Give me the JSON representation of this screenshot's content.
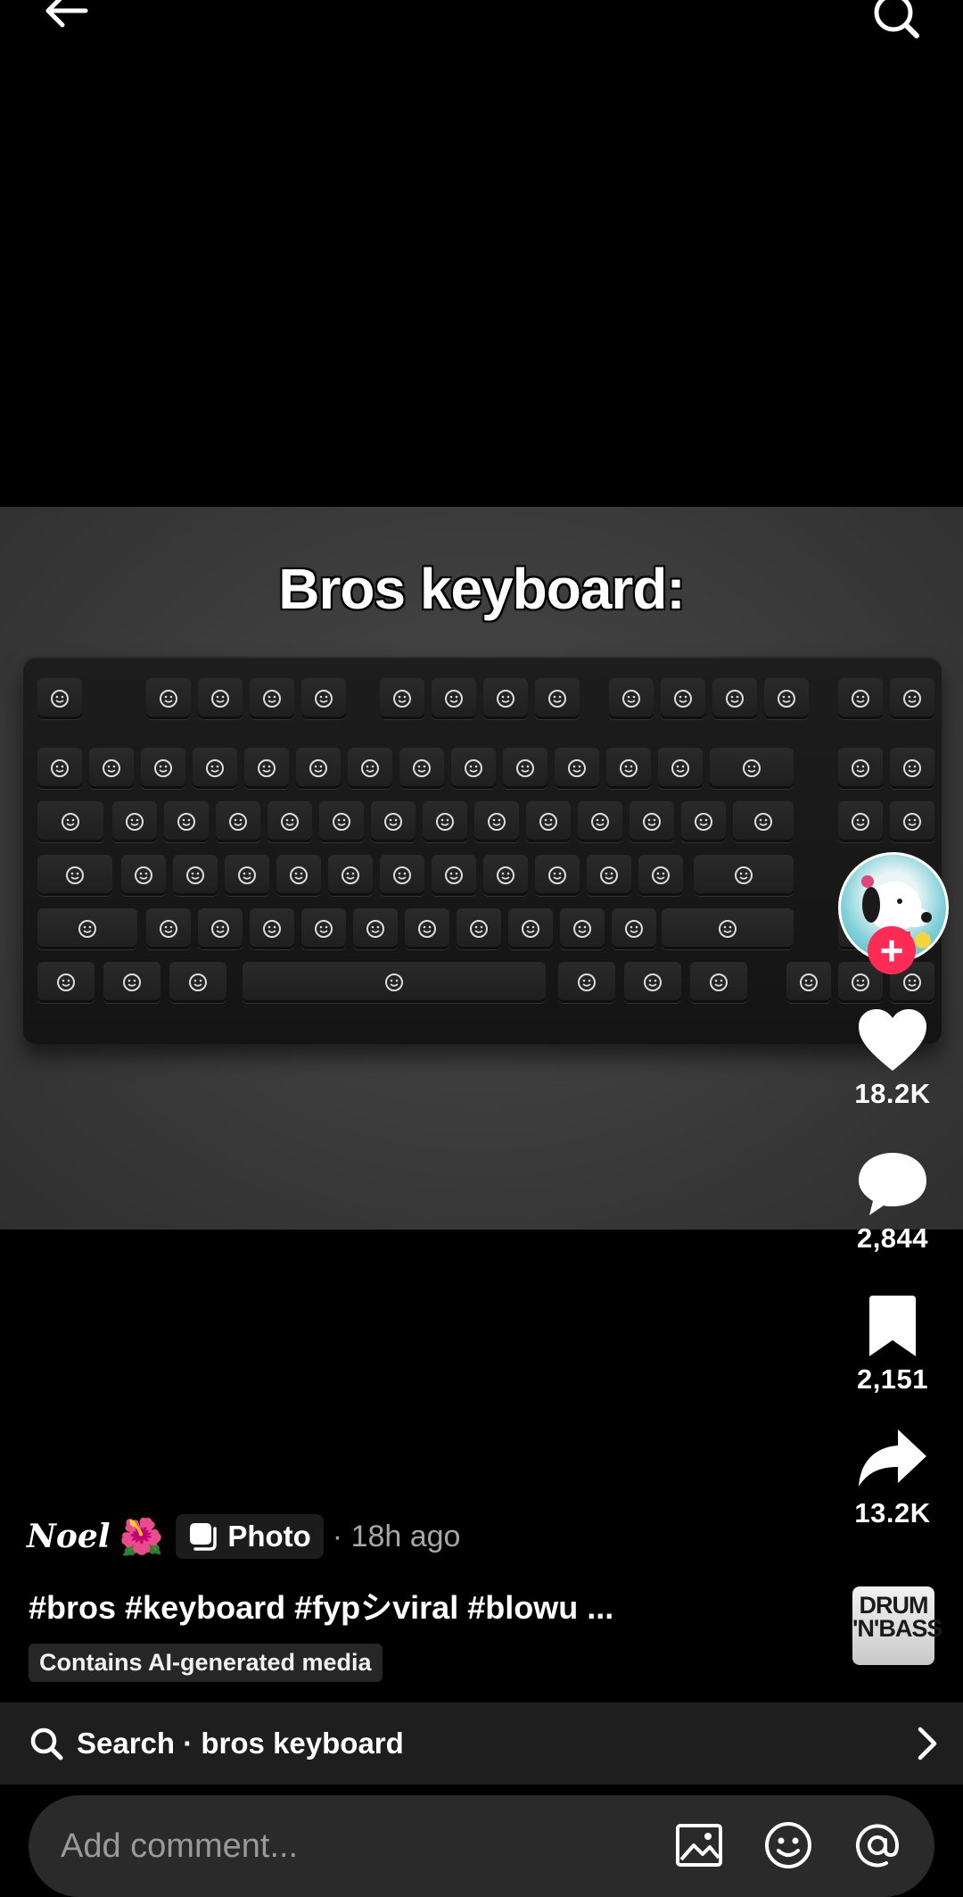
{
  "media": {
    "caption": "Bros keyboard:"
  },
  "rail": {
    "likes": "18.2K",
    "comments": "2,844",
    "saves": "2,151",
    "shares": "13.2K",
    "sound_label": "DRUM 'N'BASS"
  },
  "post": {
    "author": "Noel",
    "author_emoji": "🌺",
    "type_label": "Photo",
    "time": "· 18h ago",
    "caption": "#bros #keyboard #fypシviral #blowu ...",
    "ai_label": "Contains AI-generated media"
  },
  "search": {
    "label": "Search · bros keyboard"
  },
  "comment_bar": {
    "placeholder": "Add comment..."
  },
  "colors": {
    "accent": "#fe2c55",
    "background": "#000000",
    "muted_text": "#a6a6a6"
  },
  "icons": [
    "back-arrow-icon",
    "search-icon",
    "heart-icon",
    "comment-bubble-icon",
    "bookmark-icon",
    "share-arrow-icon",
    "photo-icon",
    "image-icon",
    "emoji-icon",
    "mention-icon",
    "chevron-right-icon"
  ]
}
